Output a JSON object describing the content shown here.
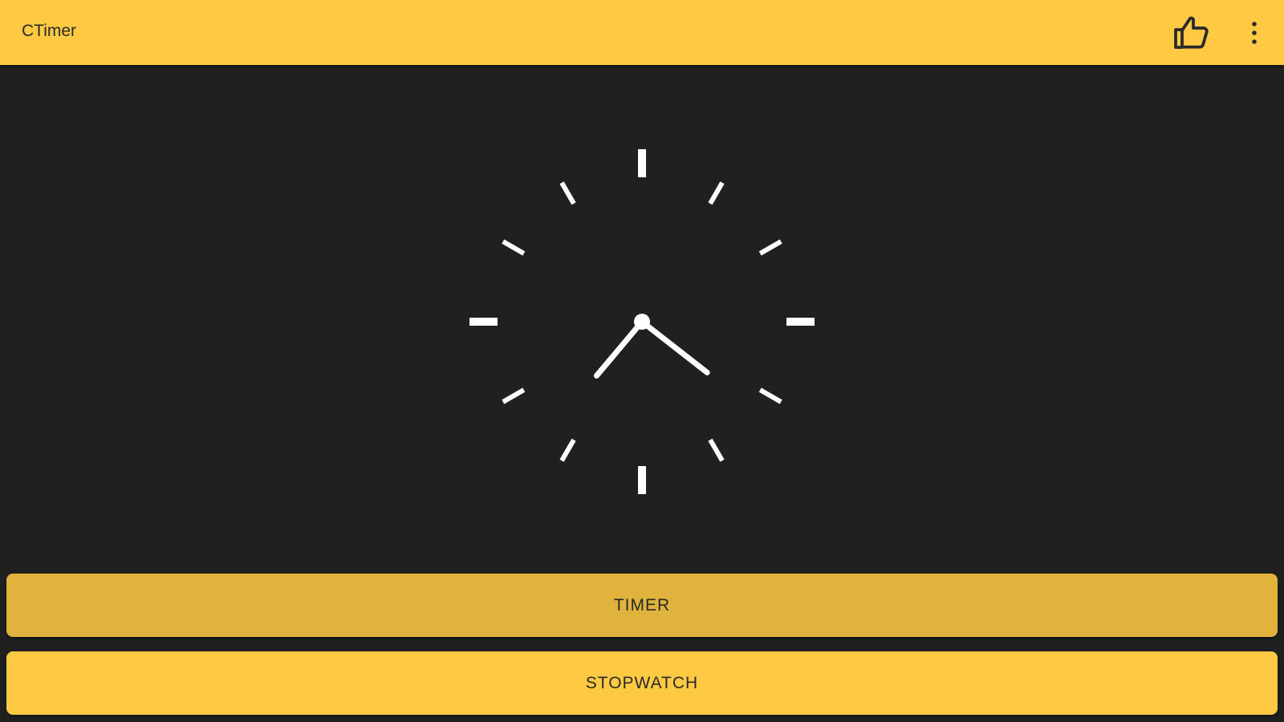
{
  "app": {
    "title": "CTimer",
    "accent_color": "#FECA43",
    "background_color": "#202020"
  },
  "toolbar": {
    "like_icon": "thumbs-up-icon",
    "more_icon": "more-vert-icon"
  },
  "clock": {
    "hour_hand_angle_deg": 220,
    "minute_hand_angle_deg": 128,
    "tick_count": 12
  },
  "buttons": {
    "timer_label": "TIMER",
    "stopwatch_label": "STOPWATCH",
    "timer_color": "#E0B33D",
    "stopwatch_color": "#FECA43"
  }
}
